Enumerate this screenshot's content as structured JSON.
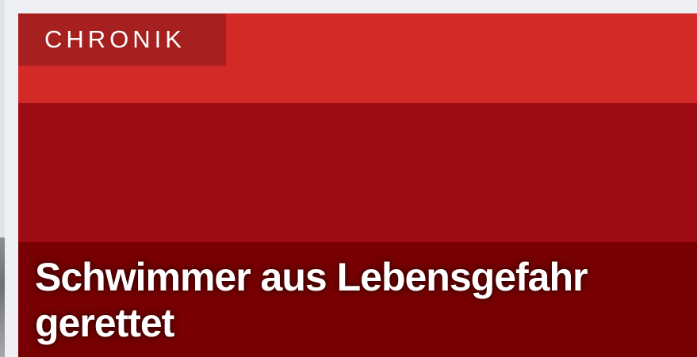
{
  "card": {
    "category": "CHRONIK",
    "headline": "Schwimmer aus Lebensgefahr gerettet"
  },
  "colors": {
    "page_background": "#eef0f4",
    "band_top": "#d42a27",
    "band_mid": "#9c0c12",
    "band_bottom": "#780003",
    "category_label_bg": "#a6201f",
    "headline_text": "#ffffff"
  }
}
